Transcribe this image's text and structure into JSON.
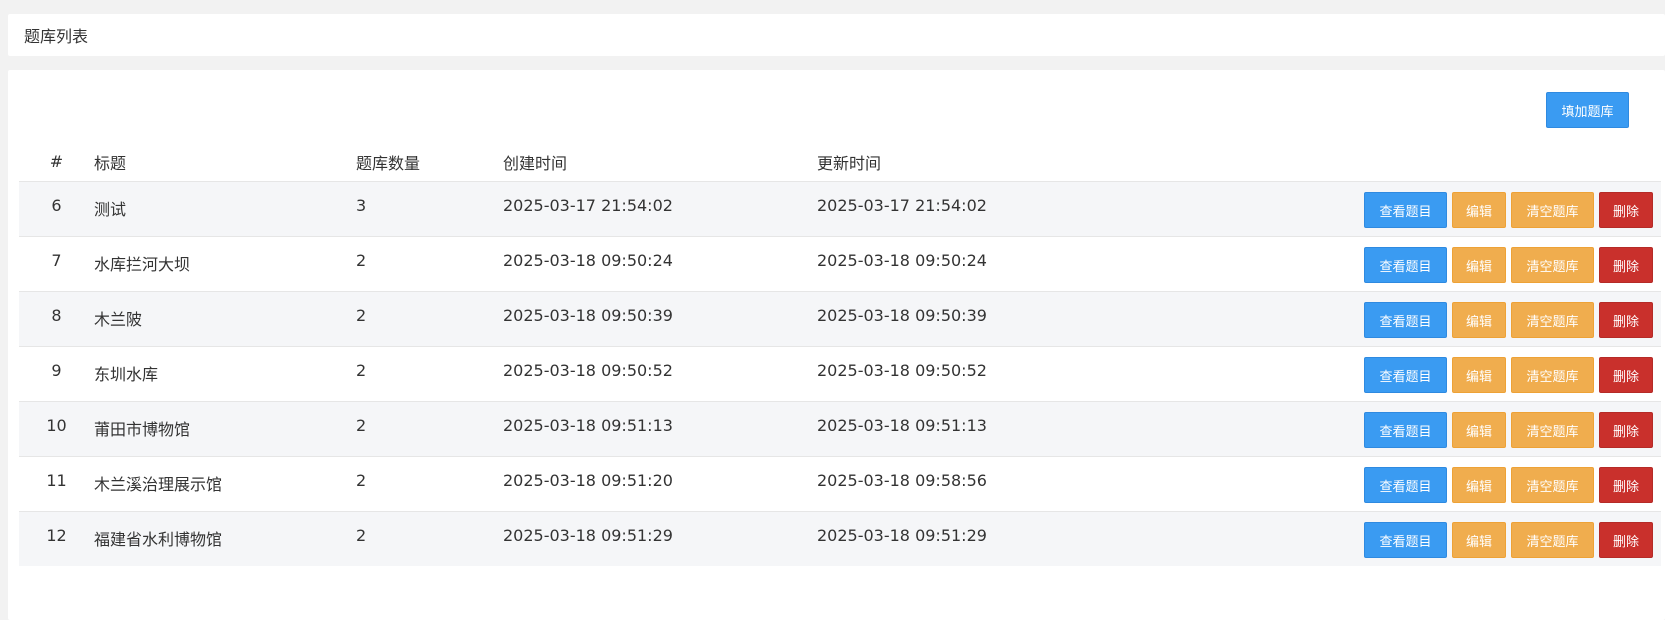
{
  "header": {
    "title": "题库列表"
  },
  "toolbar": {
    "add_label": "填加题库"
  },
  "table": {
    "columns": [
      "#",
      "标题",
      "题库数量",
      "创建时间",
      "更新时间"
    ],
    "actions": {
      "view": "查看题目",
      "edit": "编辑",
      "clear": "清空题库",
      "delete": "删除"
    },
    "rows": [
      {
        "id": "6",
        "title": "测试",
        "count": "3",
        "created": "2025-03-17 21:54:02",
        "updated": "2025-03-17 21:54:02"
      },
      {
        "id": "7",
        "title": "水库拦河大坝",
        "count": "2",
        "created": "2025-03-18 09:50:24",
        "updated": "2025-03-18 09:50:24"
      },
      {
        "id": "8",
        "title": "木兰陂",
        "count": "2",
        "created": "2025-03-18 09:50:39",
        "updated": "2025-03-18 09:50:39"
      },
      {
        "id": "9",
        "title": "东圳水库",
        "count": "2",
        "created": "2025-03-18 09:50:52",
        "updated": "2025-03-18 09:50:52"
      },
      {
        "id": "10",
        "title": "莆田市博物馆",
        "count": "2",
        "created": "2025-03-18 09:51:13",
        "updated": "2025-03-18 09:51:13"
      },
      {
        "id": "11",
        "title": "木兰溪治理展示馆",
        "count": "2",
        "created": "2025-03-18 09:51:20",
        "updated": "2025-03-18 09:58:56"
      },
      {
        "id": "12",
        "title": "福建省水利博物馆",
        "count": "2",
        "created": "2025-03-18 09:51:29",
        "updated": "2025-03-18 09:51:29"
      }
    ]
  },
  "colors": {
    "primary": "#3a9bf2",
    "warning": "#f0ad4e",
    "danger": "#c9302c"
  }
}
